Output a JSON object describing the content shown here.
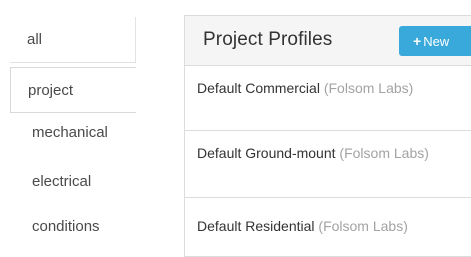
{
  "side_tabs": [
    {
      "label": "all"
    },
    {
      "label": "project"
    },
    {
      "label": "mechanical"
    },
    {
      "label": "electrical"
    },
    {
      "label": "conditions"
    }
  ],
  "panel": {
    "title": "Project Profiles",
    "new_button": {
      "icon": "plus-icon",
      "plus_symbol": "+",
      "label": "New"
    },
    "rows": [
      {
        "name": "Default Commercial",
        "org": "(Folsom Labs)"
      },
      {
        "name": "Default Ground-mount",
        "org": "(Folsom Labs)"
      },
      {
        "name": "Default Residential",
        "org": "(Folsom Labs)"
      }
    ]
  },
  "colors": {
    "accent": "#39a9db",
    "org_text": "#a3a3a3",
    "border": "#dcdcdc",
    "header_bg": "#f5f5f5"
  }
}
